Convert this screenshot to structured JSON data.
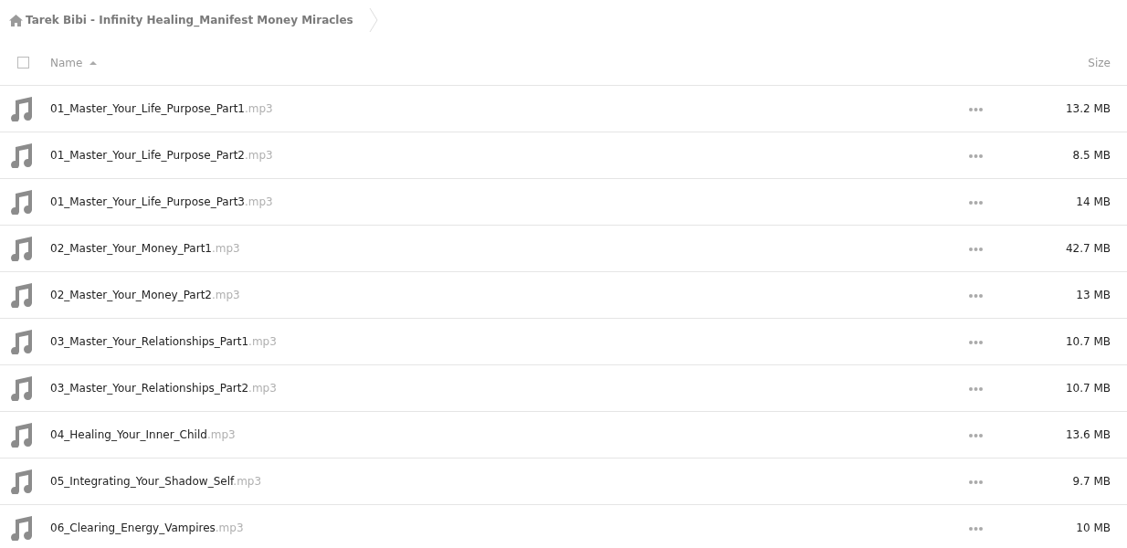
{
  "breadcrumb": {
    "label": "Tarek Bibi - Infinity Healing_Manifest Money Miracles"
  },
  "header": {
    "select_all": {
      "checked": false
    },
    "name": "Name",
    "sort_ascending": true,
    "size": "Size"
  },
  "files": [
    {
      "name": "01_Master_Your_Life_Purpose_Part1",
      "ext": ".mp3",
      "size": "13.2 MB"
    },
    {
      "name": "01_Master_Your_Life_Purpose_Part2",
      "ext": ".mp3",
      "size": "8.5 MB"
    },
    {
      "name": "01_Master_Your_Life_Purpose_Part3",
      "ext": ".mp3",
      "size": "14 MB"
    },
    {
      "name": "02_Master_Your_Money_Part1",
      "ext": ".mp3",
      "size": "42.7 MB"
    },
    {
      "name": "02_Master_Your_Money_Part2",
      "ext": ".mp3",
      "size": "13 MB"
    },
    {
      "name": "03_Master_Your_Relationships_Part1",
      "ext": ".mp3",
      "size": "10.7 MB"
    },
    {
      "name": "03_Master_Your_Relationships_Part2",
      "ext": ".mp3",
      "size": "10.7 MB"
    },
    {
      "name": "04_Healing_Your_Inner_Child",
      "ext": ".mp3",
      "size": "13.6 MB"
    },
    {
      "name": "05_Integrating_Your_Shadow_Self",
      "ext": ".mp3",
      "size": "9.7 MB"
    },
    {
      "name": "06_Clearing_Energy_Vampires",
      "ext": ".mp3",
      "size": "10 MB"
    }
  ]
}
